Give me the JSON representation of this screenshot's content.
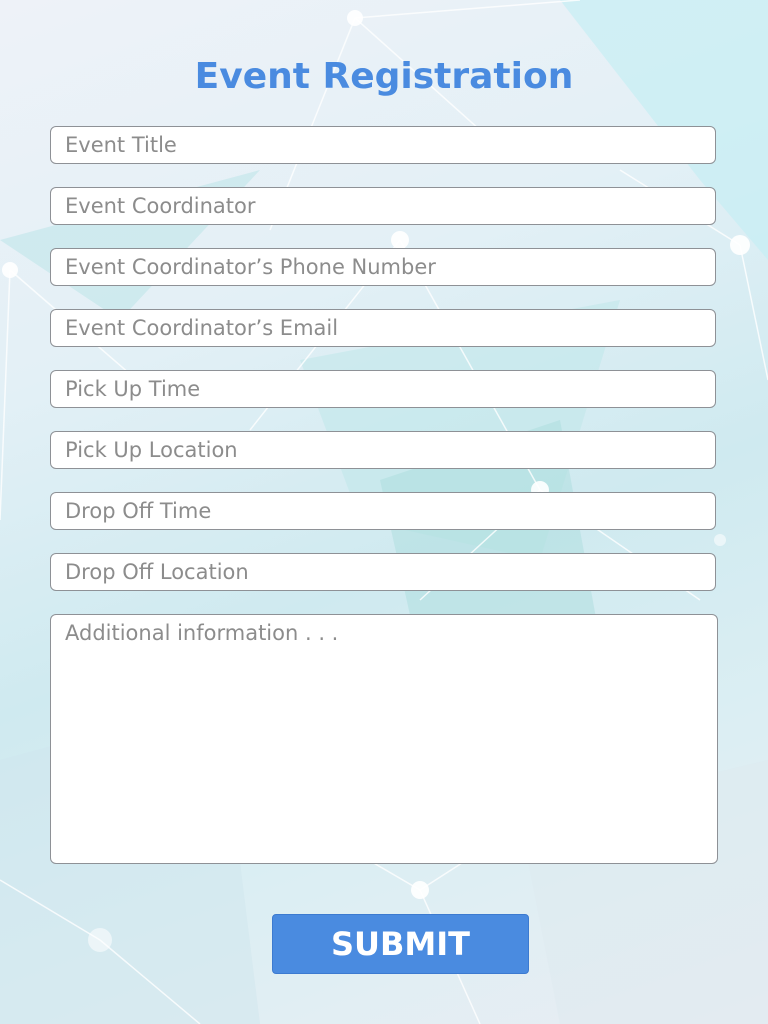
{
  "form": {
    "title": "Event Registration",
    "fields": [
      {
        "placeholder": "Event Title"
      },
      {
        "placeholder": "Event Coordinator"
      },
      {
        "placeholder": "Event Coordinator’s Phone Number"
      },
      {
        "placeholder": "Event Coordinator’s Email"
      },
      {
        "placeholder": "Pick Up Time"
      },
      {
        "placeholder": "Pick Up Location"
      },
      {
        "placeholder": "Drop Off Time"
      },
      {
        "placeholder": "Drop Off Location"
      }
    ],
    "notes_placeholder": "Additional information . . .",
    "submit_label": "SUBMIT"
  },
  "colors": {
    "accent": "#4a8be0",
    "field_border": "#8e9196",
    "placeholder": "#8c8c8c"
  }
}
